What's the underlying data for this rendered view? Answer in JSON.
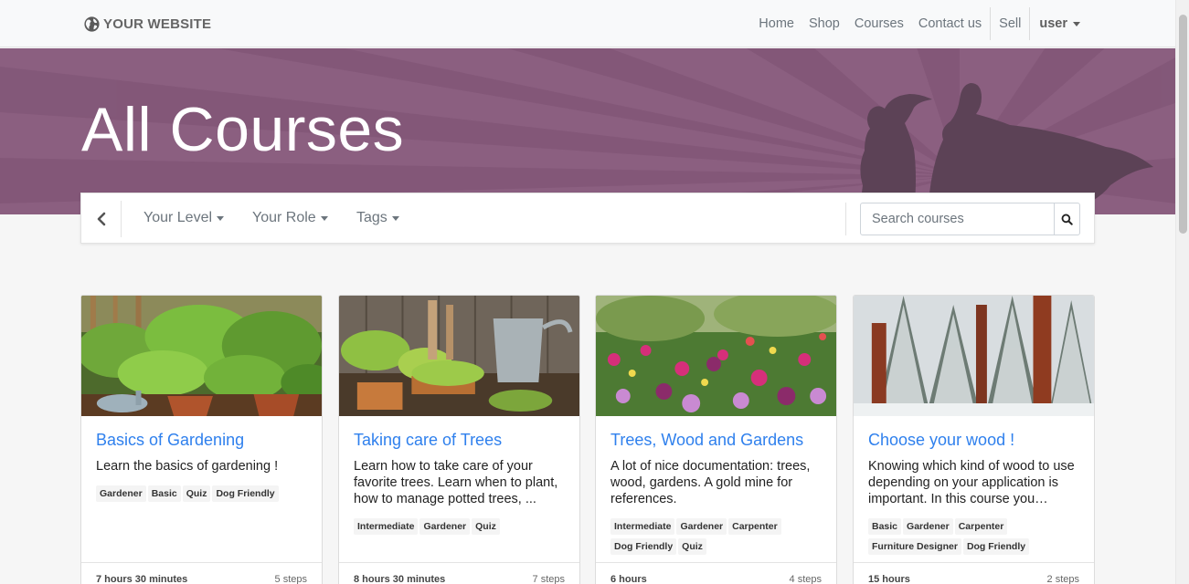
{
  "navbar": {
    "brand": "YOUR WEBSITE",
    "links": [
      "Home",
      "Shop",
      "Courses",
      "Contact us"
    ],
    "sell": "Sell",
    "user": "user"
  },
  "banner": {
    "title": "All Courses",
    "color": "#8b5f80"
  },
  "filters": {
    "back_icon": "chevron-left-icon",
    "level": "Your Level",
    "role": "Your Role",
    "tags": "Tags",
    "search_placeholder": "Search courses",
    "search_icon": "search-icon"
  },
  "courses": [
    {
      "title": "Basics of Gardening",
      "description": "Learn the basics of gardening !",
      "tags": [
        "Gardener",
        "Basic",
        "Quiz",
        "Dog Friendly"
      ],
      "duration": "7 hours 30 minutes",
      "steps": "5 steps"
    },
    {
      "title": "Taking care of Trees",
      "description": "Learn how to take care of your favorite trees. Learn when to plant, how to manage potted trees, ...",
      "tags": [
        "Intermediate",
        "Gardener",
        "Quiz"
      ],
      "duration": "8 hours 30 minutes",
      "steps": "7 steps"
    },
    {
      "title": "Trees, Wood and Gardens",
      "description": "A lot of nice documentation: trees, wood, gardens. A gold mine for references.",
      "tags": [
        "Intermediate",
        "Gardener",
        "Carpenter",
        "Dog Friendly",
        "Quiz"
      ],
      "duration": "6 hours",
      "steps": "4 steps"
    },
    {
      "title": "Choose your wood !",
      "description": "Knowing which kind of wood to use depending on your application is important. In this course you…",
      "tags": [
        "Basic",
        "Gardener",
        "Carpenter",
        "Furniture Designer",
        "Dog Friendly"
      ],
      "duration": "15 hours",
      "steps": "2 steps"
    }
  ],
  "colors": {
    "link": "#2f80ed",
    "banner": "#8b5f80"
  }
}
